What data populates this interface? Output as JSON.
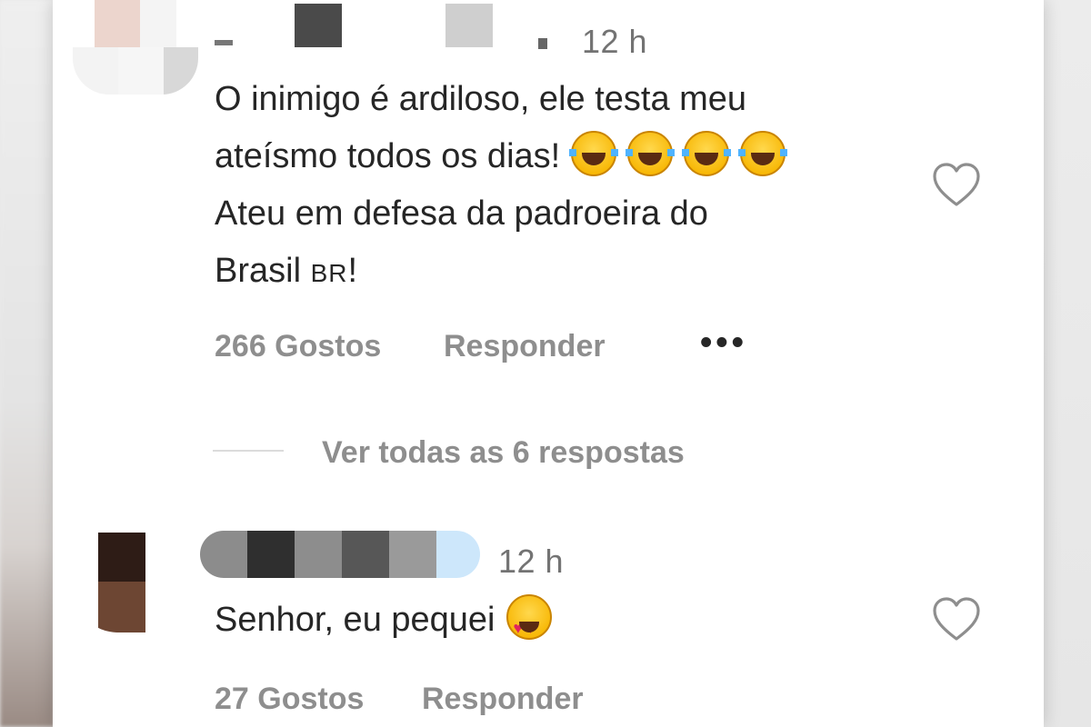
{
  "comments": [
    {
      "time": "12 h",
      "text_lines": [
        "O inimigo é ardiloso, ele testa meu",
        "ateísmo todos os dias!",
        "Ateu em defesa da padroeira do",
        "Brasil"
      ],
      "flag": "BR",
      "flag_tail": "!",
      "likes": "266 Gostos",
      "reply_label": "Responder",
      "more_label": "•••",
      "view_replies": "Ver todas as 6 respostas",
      "emojis": [
        "face-with-tears-of-joy-icon",
        "face-with-tears-of-joy-icon",
        "face-with-tears-of-joy-icon",
        "face-with-tears-of-joy-icon"
      ]
    },
    {
      "time": "12 h",
      "text": "Senhor, eu pequei",
      "likes": "27 Gostos",
      "reply_label": "Responder",
      "emojis": [
        "smiling-face-with-heart-eyes-icon"
      ]
    }
  ],
  "colors": {
    "text": "#262626",
    "meta": "#8e8e8e",
    "time": "#737373",
    "background": "#ffffff"
  }
}
